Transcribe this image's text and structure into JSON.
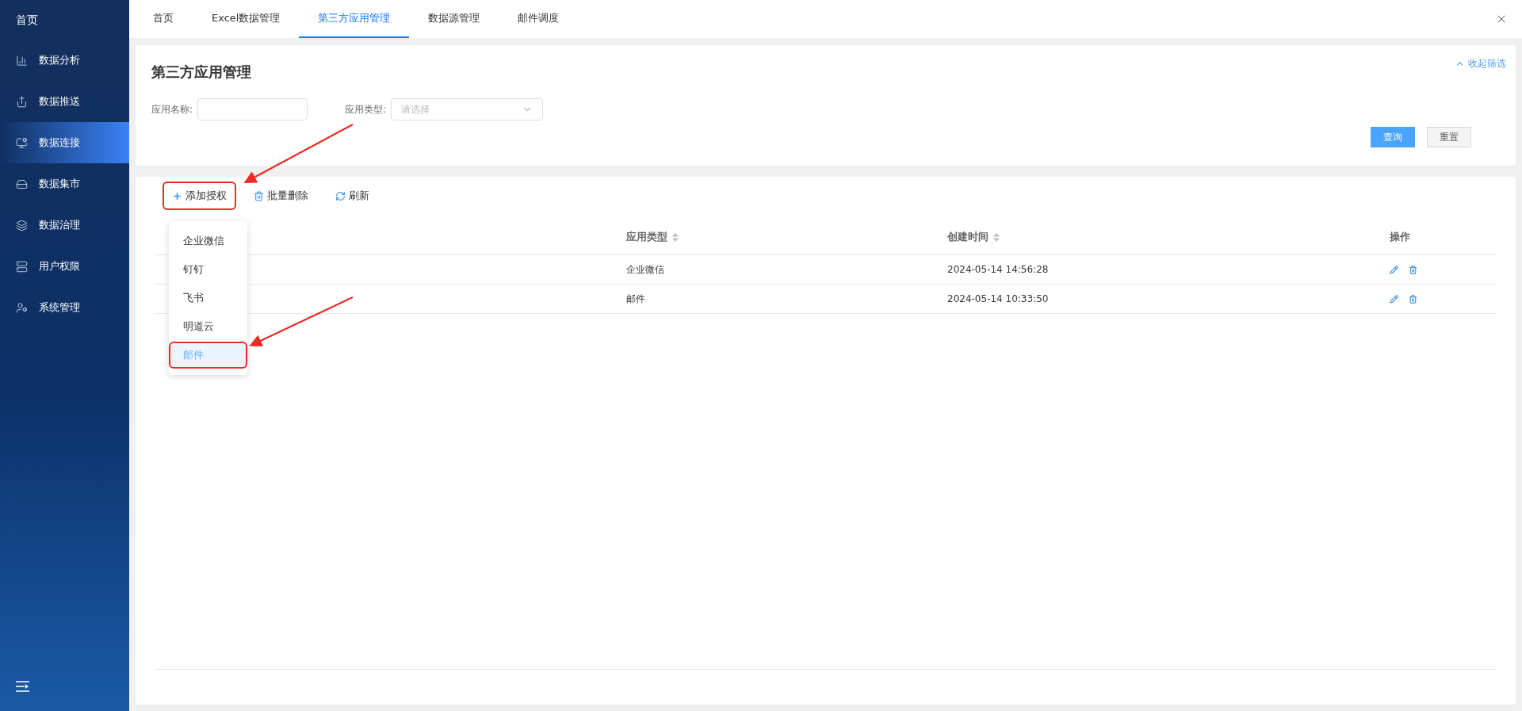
{
  "sidebar": {
    "home": "首页",
    "items": [
      {
        "label": "数据分析",
        "selected": false
      },
      {
        "label": "数据推送",
        "selected": false
      },
      {
        "label": "数据连接",
        "selected": true
      },
      {
        "label": "数据集市",
        "selected": false
      },
      {
        "label": "数据治理",
        "selected": false
      },
      {
        "label": "用户权限",
        "selected": false
      },
      {
        "label": "系统管理",
        "selected": false
      }
    ]
  },
  "tabs": [
    {
      "label": "首页",
      "selected": false
    },
    {
      "label": "Excel数据管理",
      "selected": false
    },
    {
      "label": "第三方应用管理",
      "selected": true
    },
    {
      "label": "数据源管理",
      "selected": false
    },
    {
      "label": "邮件调度",
      "selected": false
    }
  ],
  "filter": {
    "title": "第三方应用管理",
    "collapse": "收起筛选",
    "name_label": "应用名称:",
    "type_label": "应用类型:",
    "type_placeholder": "请选择",
    "query": "查询",
    "reset": "重置"
  },
  "toolbar": [
    {
      "label": "添加授权",
      "annotated": true
    },
    {
      "label": "批量删除",
      "annotated": false
    },
    {
      "label": "刷新",
      "annotated": false
    }
  ],
  "menu": [
    {
      "label": "企业微信",
      "selected": false,
      "annotated": false
    },
    {
      "label": "钉钉",
      "selected": false,
      "annotated": false
    },
    {
      "label": "飞书",
      "selected": false,
      "annotated": false
    },
    {
      "label": "明道云",
      "selected": false,
      "annotated": false
    },
    {
      "label": "邮件",
      "selected": true,
      "annotated": true
    }
  ],
  "table": {
    "columns": [
      {
        "label": "应用类型",
        "sortable": true
      },
      {
        "label": "创建时间",
        "sortable": true
      },
      {
        "label": "操作",
        "sortable": false
      }
    ],
    "rows": [
      {
        "type": "企业微信",
        "created": "2024-05-14 14:56:28"
      },
      {
        "type": "邮件",
        "created": "2024-05-14 10:33:50"
      }
    ]
  }
}
